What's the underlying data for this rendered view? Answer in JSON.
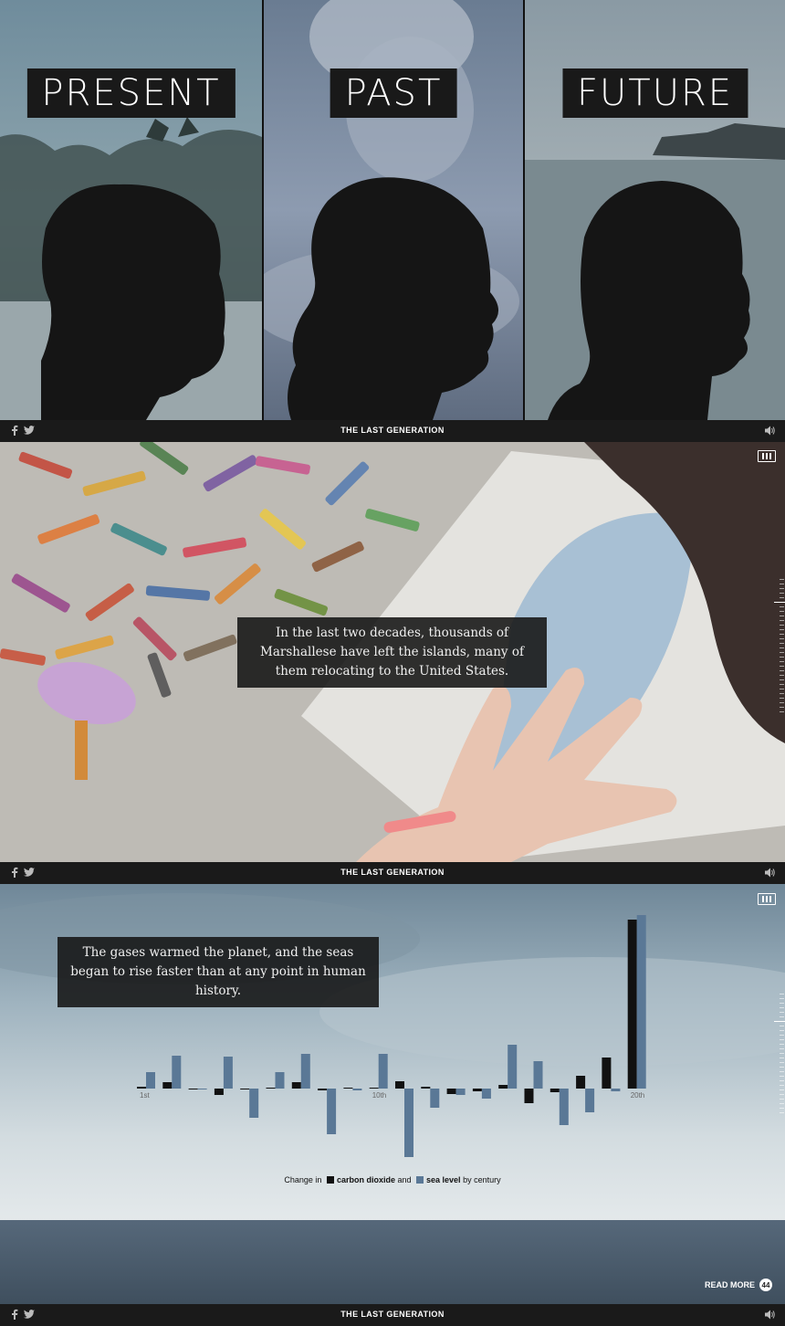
{
  "header": {
    "site_title": "THE LAST GENERATION"
  },
  "triptych": [
    {
      "label": "PRESENT"
    },
    {
      "label": "PAST"
    },
    {
      "label": "FUTURE"
    }
  ],
  "scene2": {
    "caption": "In the last two decades, thousands of Marshallese have left the islands, many of them relocating to the United States."
  },
  "scene3": {
    "caption": "The gases warmed the planet, and the seas began to rise faster than at any point in human history.",
    "read_more": "READ MORE",
    "read_more_icon_text": "44"
  },
  "chart_data": {
    "type": "bar",
    "categories": [
      "1st",
      "2nd",
      "3rd",
      "4th",
      "5th",
      "6th",
      "7th",
      "8th",
      "9th",
      "10th",
      "11th",
      "12th",
      "13th",
      "14th",
      "15th",
      "16th",
      "17th",
      "18th",
      "19th",
      "20th"
    ],
    "tick_labels": {
      "1st": "1st",
      "10th": "10th",
      "20th": "20th"
    },
    "series": [
      {
        "name": "carbon dioxide",
        "color": "#111111",
        "values": [
          2,
          7,
          -1,
          -7,
          -1,
          1,
          7,
          -2,
          1,
          0,
          8,
          2,
          -6,
          -3,
          4,
          -16,
          -4,
          14,
          34,
          185
        ]
      },
      {
        "name": "sea level",
        "color": "#5a7896",
        "values": [
          18,
          36,
          -1,
          35,
          -32,
          18,
          38,
          -50,
          -2,
          38,
          -75,
          -21,
          -7,
          -11,
          48,
          30,
          -40,
          -26,
          -3,
          190
        ]
      }
    ],
    "caption_parts": {
      "prefix": "Change in",
      "series1": "carbon dioxide",
      "and": "and",
      "series2": "sea level",
      "suffix": "by century"
    },
    "colors": {
      "carbon_dioxide": "#111111",
      "sea_level": "#5a7896"
    }
  }
}
